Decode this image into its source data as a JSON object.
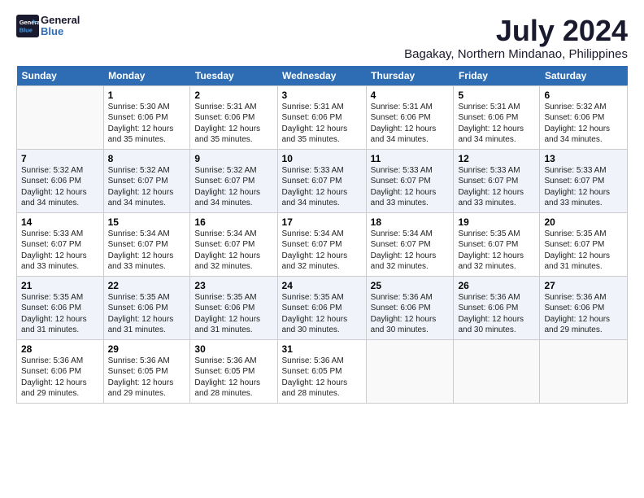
{
  "logo": {
    "line1": "General",
    "line2": "Blue"
  },
  "title": "July 2024",
  "location": "Bagakay, Northern Mindanao, Philippines",
  "headers": [
    "Sunday",
    "Monday",
    "Tuesday",
    "Wednesday",
    "Thursday",
    "Friday",
    "Saturday"
  ],
  "weeks": [
    [
      {
        "day": "",
        "info": ""
      },
      {
        "day": "1",
        "info": "Sunrise: 5:30 AM\nSunset: 6:06 PM\nDaylight: 12 hours\nand 35 minutes."
      },
      {
        "day": "2",
        "info": "Sunrise: 5:31 AM\nSunset: 6:06 PM\nDaylight: 12 hours\nand 35 minutes."
      },
      {
        "day": "3",
        "info": "Sunrise: 5:31 AM\nSunset: 6:06 PM\nDaylight: 12 hours\nand 35 minutes."
      },
      {
        "day": "4",
        "info": "Sunrise: 5:31 AM\nSunset: 6:06 PM\nDaylight: 12 hours\nand 34 minutes."
      },
      {
        "day": "5",
        "info": "Sunrise: 5:31 AM\nSunset: 6:06 PM\nDaylight: 12 hours\nand 34 minutes."
      },
      {
        "day": "6",
        "info": "Sunrise: 5:32 AM\nSunset: 6:06 PM\nDaylight: 12 hours\nand 34 minutes."
      }
    ],
    [
      {
        "day": "7",
        "info": "Sunrise: 5:32 AM\nSunset: 6:06 PM\nDaylight: 12 hours\nand 34 minutes."
      },
      {
        "day": "8",
        "info": "Sunrise: 5:32 AM\nSunset: 6:07 PM\nDaylight: 12 hours\nand 34 minutes."
      },
      {
        "day": "9",
        "info": "Sunrise: 5:32 AM\nSunset: 6:07 PM\nDaylight: 12 hours\nand 34 minutes."
      },
      {
        "day": "10",
        "info": "Sunrise: 5:33 AM\nSunset: 6:07 PM\nDaylight: 12 hours\nand 34 minutes."
      },
      {
        "day": "11",
        "info": "Sunrise: 5:33 AM\nSunset: 6:07 PM\nDaylight: 12 hours\nand 33 minutes."
      },
      {
        "day": "12",
        "info": "Sunrise: 5:33 AM\nSunset: 6:07 PM\nDaylight: 12 hours\nand 33 minutes."
      },
      {
        "day": "13",
        "info": "Sunrise: 5:33 AM\nSunset: 6:07 PM\nDaylight: 12 hours\nand 33 minutes."
      }
    ],
    [
      {
        "day": "14",
        "info": "Sunrise: 5:33 AM\nSunset: 6:07 PM\nDaylight: 12 hours\nand 33 minutes."
      },
      {
        "day": "15",
        "info": "Sunrise: 5:34 AM\nSunset: 6:07 PM\nDaylight: 12 hours\nand 33 minutes."
      },
      {
        "day": "16",
        "info": "Sunrise: 5:34 AM\nSunset: 6:07 PM\nDaylight: 12 hours\nand 32 minutes."
      },
      {
        "day": "17",
        "info": "Sunrise: 5:34 AM\nSunset: 6:07 PM\nDaylight: 12 hours\nand 32 minutes."
      },
      {
        "day": "18",
        "info": "Sunrise: 5:34 AM\nSunset: 6:07 PM\nDaylight: 12 hours\nand 32 minutes."
      },
      {
        "day": "19",
        "info": "Sunrise: 5:35 AM\nSunset: 6:07 PM\nDaylight: 12 hours\nand 32 minutes."
      },
      {
        "day": "20",
        "info": "Sunrise: 5:35 AM\nSunset: 6:07 PM\nDaylight: 12 hours\nand 31 minutes."
      }
    ],
    [
      {
        "day": "21",
        "info": "Sunrise: 5:35 AM\nSunset: 6:06 PM\nDaylight: 12 hours\nand 31 minutes."
      },
      {
        "day": "22",
        "info": "Sunrise: 5:35 AM\nSunset: 6:06 PM\nDaylight: 12 hours\nand 31 minutes."
      },
      {
        "day": "23",
        "info": "Sunrise: 5:35 AM\nSunset: 6:06 PM\nDaylight: 12 hours\nand 31 minutes."
      },
      {
        "day": "24",
        "info": "Sunrise: 5:35 AM\nSunset: 6:06 PM\nDaylight: 12 hours\nand 30 minutes."
      },
      {
        "day": "25",
        "info": "Sunrise: 5:36 AM\nSunset: 6:06 PM\nDaylight: 12 hours\nand 30 minutes."
      },
      {
        "day": "26",
        "info": "Sunrise: 5:36 AM\nSunset: 6:06 PM\nDaylight: 12 hours\nand 30 minutes."
      },
      {
        "day": "27",
        "info": "Sunrise: 5:36 AM\nSunset: 6:06 PM\nDaylight: 12 hours\nand 29 minutes."
      }
    ],
    [
      {
        "day": "28",
        "info": "Sunrise: 5:36 AM\nSunset: 6:06 PM\nDaylight: 12 hours\nand 29 minutes."
      },
      {
        "day": "29",
        "info": "Sunrise: 5:36 AM\nSunset: 6:05 PM\nDaylight: 12 hours\nand 29 minutes."
      },
      {
        "day": "30",
        "info": "Sunrise: 5:36 AM\nSunset: 6:05 PM\nDaylight: 12 hours\nand 28 minutes."
      },
      {
        "day": "31",
        "info": "Sunrise: 5:36 AM\nSunset: 6:05 PM\nDaylight: 12 hours\nand 28 minutes."
      },
      {
        "day": "",
        "info": ""
      },
      {
        "day": "",
        "info": ""
      },
      {
        "day": "",
        "info": ""
      }
    ]
  ]
}
